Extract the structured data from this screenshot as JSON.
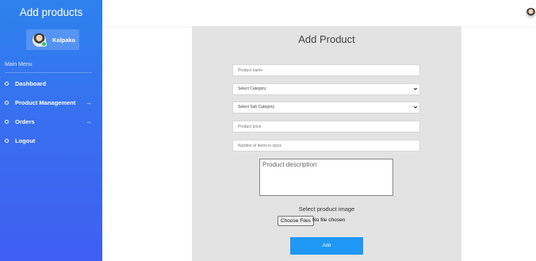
{
  "sidebar": {
    "title": "Add products",
    "user": {
      "name": "Kalpaka"
    },
    "menu_heading": "Main Menu",
    "items": [
      {
        "label": "Dashboard",
        "arrow": ""
      },
      {
        "label": "Product Management",
        "arrow": "→"
      },
      {
        "label": "Orders",
        "arrow": "→"
      },
      {
        "label": "Logout",
        "arrow": ""
      }
    ]
  },
  "form": {
    "title": "Add Product",
    "product_name_placeholder": "Product name",
    "category_selected": "Select Category",
    "subcategory_selected": "Select Sub Category",
    "price_placeholder": "Product price",
    "stock_placeholder": "Number of items in stock",
    "description_placeholder": "Product description",
    "image_label": "Select product image",
    "choose_files_label": "Choose Files",
    "no_file_text": "No file chosen",
    "submit_label": "Add"
  },
  "colors": {
    "sidebar_gradient_top": "#2d82ee",
    "sidebar_gradient_bottom": "#3f5ef2",
    "panel_bg": "#e3e3e3",
    "add_button": "#1f97f4"
  },
  "icons": {
    "menu_bullet": "circle-icon",
    "menu_arrow": "arrow-right-icon",
    "select_chevron": "chevron-down-icon"
  }
}
